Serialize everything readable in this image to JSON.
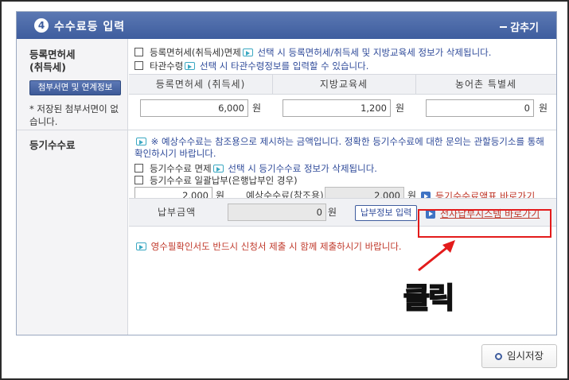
{
  "section": {
    "step_number": "4",
    "title": "수수료등 입력",
    "collapse_label": "감추기"
  },
  "registration_tax": {
    "title_line1": "등록면허세",
    "title_line2": "(취득세)",
    "attach_button": "첨부서면 및 연계정보",
    "saved_note": "저장된 첨부서면이 없습니다.",
    "exempt_checkbox_label": "등록면허세(취득세)면제",
    "exempt_note": "선택 시 등록면허세/취득세 및 지방교육세 정보가 삭제됩니다.",
    "other_jurisdiction_label": "타관수령",
    "other_jurisdiction_note": "선택 시 타관수령정보를 입력할 수 있습니다.",
    "columns": [
      "등록면허세 (취득세)",
      "지방교육세",
      "농어촌 특별세"
    ],
    "values": [
      "6,000",
      "1,200",
      "0"
    ],
    "unit": "원"
  },
  "registry_fee": {
    "title": "등기수수료",
    "notice": "※ 예상수수료는 참조용으로 제시하는 금액입니다. 정확한 등기수수료에 대한 문의는 관할등기소를 통해 확인하시기 바랍니다.",
    "exempt_label": "등기수수료 면제",
    "exempt_note": "선택 시 등기수수료 정보가 삭제됩니다.",
    "bulk_label": "등기수수료 일괄납부(은행납부인 경우)",
    "fee_value": "2,000",
    "unit": "원",
    "expected_label": "예상수수료(참조용)",
    "expected_value": "2,000",
    "fee_table_link": "등기수수료액표 바로가기",
    "payment_label": "납부금액",
    "payment_value": "0",
    "payment_info_button": "납부정보 입력",
    "epay_link": "전자납부시스템 바로가기",
    "receipt_note": "영수필확인서도 반드시 신청서 제출 시 함께 제출하시기 바랍니다."
  },
  "annotation": {
    "click_text": "클릭"
  },
  "footer": {
    "temp_save_button": "임시저장"
  },
  "colors": {
    "header": "#3e5d9e",
    "highlight": "#e31b1b",
    "annotation": "#ffd400",
    "link": "#c0392b"
  }
}
